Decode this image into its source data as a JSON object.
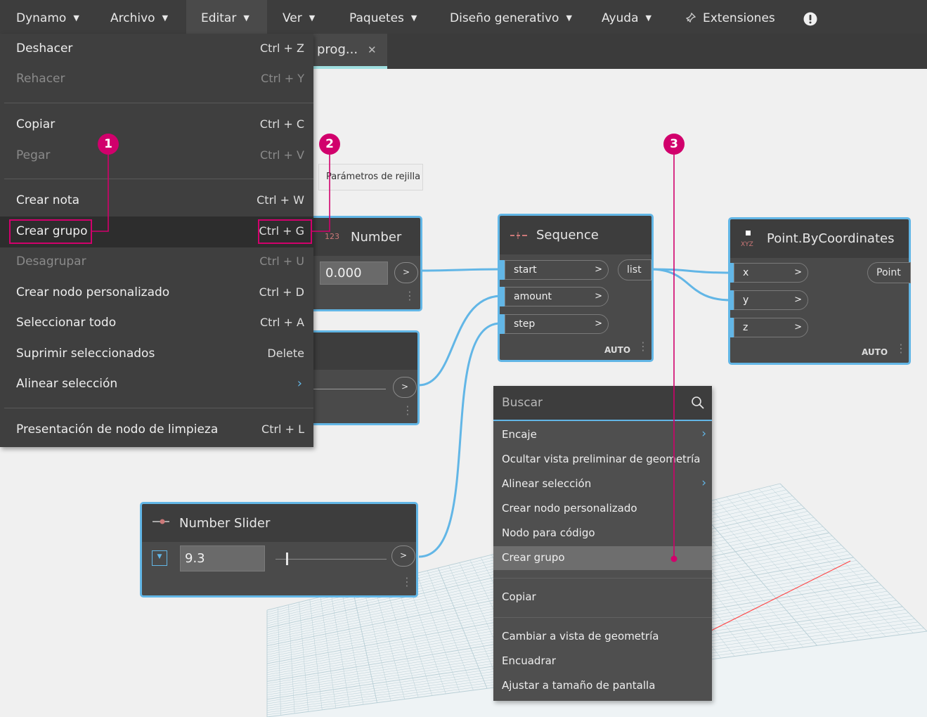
{
  "menubar": {
    "items": [
      "Dynamo",
      "Archivo",
      "Editar",
      "Ver",
      "Paquetes",
      "Diseño generativo",
      "Ayuda",
      "Extensiones"
    ],
    "alert_icon": "exclamation-icon",
    "extensions_icon": "pin-icon"
  },
  "tab": {
    "label": "prog...",
    "close": "✕"
  },
  "edit_menu": {
    "undo": {
      "label": "Deshacer",
      "shortcut": "Ctrl + Z"
    },
    "redo": {
      "label": "Rehacer",
      "shortcut": "Ctrl + Y"
    },
    "copy": {
      "label": "Copiar",
      "shortcut": "Ctrl + C"
    },
    "paste": {
      "label": "Pegar",
      "shortcut": "Ctrl + V"
    },
    "create_note": {
      "label": "Crear nota",
      "shortcut": "Ctrl + W"
    },
    "create_group": {
      "label": "Crear grupo",
      "shortcut": "Ctrl + G"
    },
    "ungroup": {
      "label": "Desagrupar",
      "shortcut": "Ctrl + U"
    },
    "create_custom_node": {
      "label": "Crear nodo personalizado",
      "shortcut": "Ctrl + D"
    },
    "select_all": {
      "label": "Seleccionar todo",
      "shortcut": "Ctrl + A"
    },
    "delete_selected": {
      "label": "Suprimir seleccionados",
      "shortcut": "Delete"
    },
    "align_selection": {
      "label": "Alinear selección"
    },
    "cleanup_layout": {
      "label": "Presentación de nodo de limpieza",
      "shortcut": "Ctrl + L"
    }
  },
  "tooltip": "Parámetros de rejilla",
  "nodes": {
    "number": {
      "title": "Number",
      "badge": "123",
      "value": "0.000",
      "out": ">"
    },
    "sequence": {
      "title": "Sequence",
      "inputs": [
        "start",
        "amount",
        "step"
      ],
      "output": "list",
      "lacing": "AUTO"
    },
    "point": {
      "title": "Point.ByCoordinates",
      "badge": "XYZ",
      "inputs": [
        "x",
        "y",
        "z"
      ],
      "output": "Point",
      "lacing": "AUTO"
    },
    "slider": {
      "title": "Number Slider",
      "value": "9.3",
      "out": ">"
    },
    "hidden_out": ">"
  },
  "context_menu": {
    "search_placeholder": "Buscar",
    "items": [
      "Encaje",
      "Ocultar vista preliminar de geometría",
      "Alinear selección",
      "Crear nodo personalizado",
      "Nodo para código",
      "Crear grupo",
      "Copiar",
      "Cambiar a vista de geometría",
      "Encuadrar",
      "Ajustar a tamaño de pantalla"
    ]
  },
  "callouts": [
    "1",
    "2",
    "3"
  ],
  "colors": {
    "accent": "#62b6e6",
    "callout": "#d1006c",
    "menu_bg": "#3f3f3f",
    "node_bg": "#4a4a4a",
    "grid_axis": "#ff4a4a"
  }
}
